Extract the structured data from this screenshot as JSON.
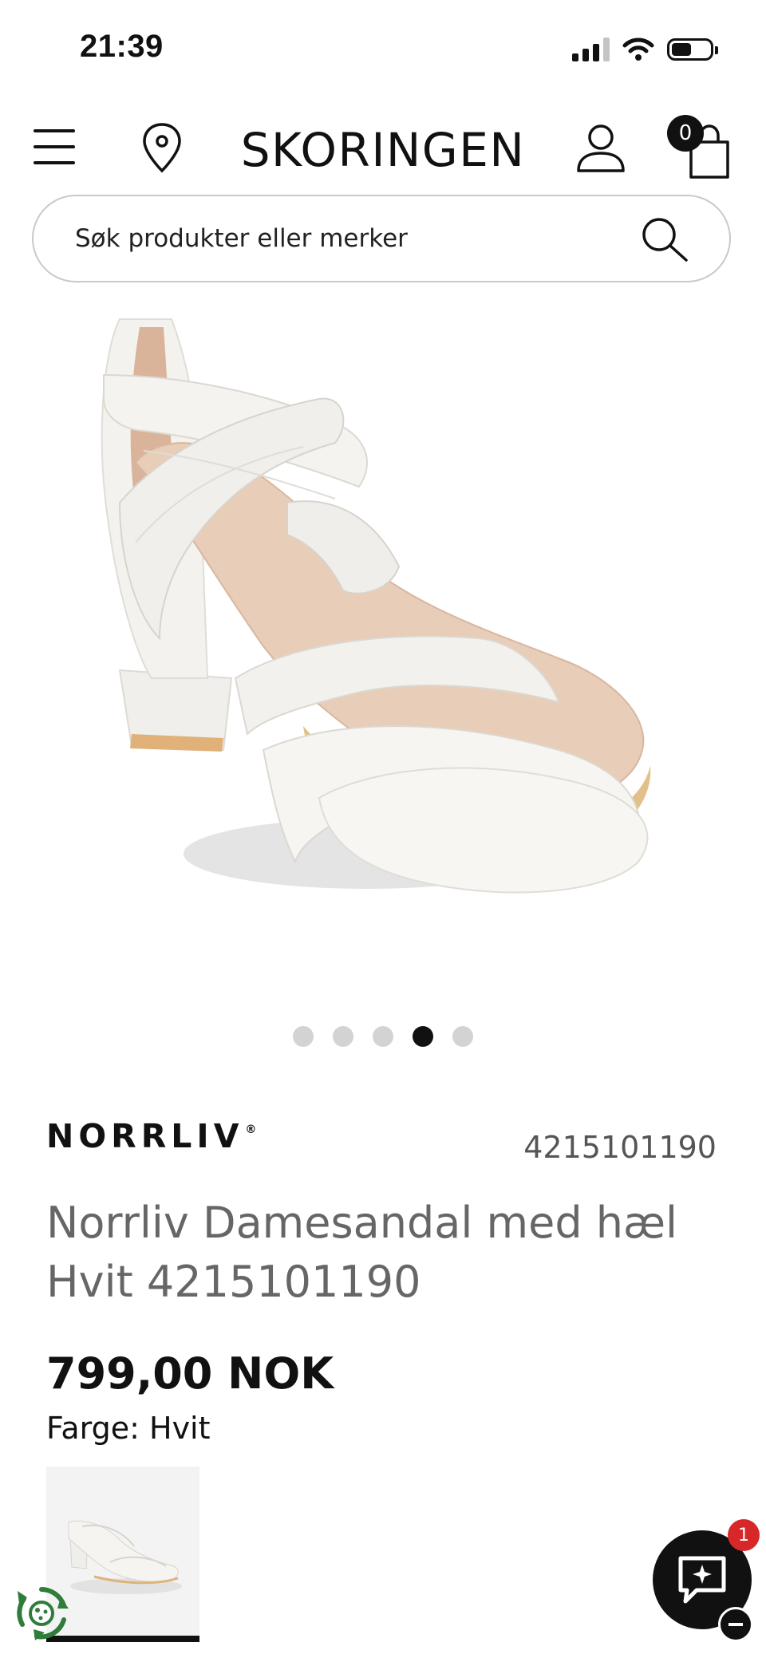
{
  "status_bar": {
    "time": "21:39",
    "icons": [
      "cellular-signal-icon",
      "wifi-icon",
      "battery-icon"
    ]
  },
  "header": {
    "logo": "SKORINGEN",
    "cart_count": "0",
    "icons": [
      "hamburger-menu-icon",
      "location-pin-icon",
      "user-icon",
      "shopping-bag-icon"
    ]
  },
  "search": {
    "placeholder": "Søk produkter eller merker",
    "value": ""
  },
  "gallery": {
    "image_alt": "white heeled sandal",
    "total_images": 5,
    "active_index": 4
  },
  "product": {
    "brand": "NORRLIV",
    "brand_mark": "®",
    "sku": "4215101190",
    "title": "Norrliv Damesandal med hæl Hvit 4215101190",
    "price": "799,00 NOK",
    "color_label": "Farge: Hvit"
  },
  "chat": {
    "badge_count": "1",
    "icons": [
      "chat-sparkle-icon",
      "minimize-icon"
    ]
  },
  "colors": {
    "text": "#111111",
    "muted": "#666666",
    "badge": "#d62828",
    "border": "#c9c9c9",
    "recycle_green": "#2f7d3a"
  }
}
